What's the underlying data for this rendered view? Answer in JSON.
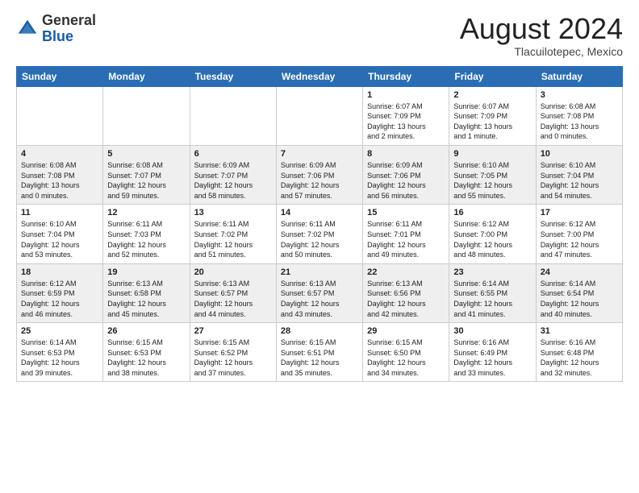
{
  "header": {
    "logo_general": "General",
    "logo_blue": "Blue",
    "month_year": "August 2024",
    "location": "Tlacuilotepec, Mexico"
  },
  "days_of_week": [
    "Sunday",
    "Monday",
    "Tuesday",
    "Wednesday",
    "Thursday",
    "Friday",
    "Saturday"
  ],
  "weeks": [
    [
      {
        "day": "",
        "info": ""
      },
      {
        "day": "",
        "info": ""
      },
      {
        "day": "",
        "info": ""
      },
      {
        "day": "",
        "info": ""
      },
      {
        "day": "1",
        "info": "Sunrise: 6:07 AM\nSunset: 7:09 PM\nDaylight: 13 hours\nand 2 minutes."
      },
      {
        "day": "2",
        "info": "Sunrise: 6:07 AM\nSunset: 7:09 PM\nDaylight: 13 hours\nand 1 minute."
      },
      {
        "day": "3",
        "info": "Sunrise: 6:08 AM\nSunset: 7:08 PM\nDaylight: 13 hours\nand 0 minutes."
      }
    ],
    [
      {
        "day": "4",
        "info": "Sunrise: 6:08 AM\nSunset: 7:08 PM\nDaylight: 13 hours\nand 0 minutes."
      },
      {
        "day": "5",
        "info": "Sunrise: 6:08 AM\nSunset: 7:07 PM\nDaylight: 12 hours\nand 59 minutes."
      },
      {
        "day": "6",
        "info": "Sunrise: 6:09 AM\nSunset: 7:07 PM\nDaylight: 12 hours\nand 58 minutes."
      },
      {
        "day": "7",
        "info": "Sunrise: 6:09 AM\nSunset: 7:06 PM\nDaylight: 12 hours\nand 57 minutes."
      },
      {
        "day": "8",
        "info": "Sunrise: 6:09 AM\nSunset: 7:06 PM\nDaylight: 12 hours\nand 56 minutes."
      },
      {
        "day": "9",
        "info": "Sunrise: 6:10 AM\nSunset: 7:05 PM\nDaylight: 12 hours\nand 55 minutes."
      },
      {
        "day": "10",
        "info": "Sunrise: 6:10 AM\nSunset: 7:04 PM\nDaylight: 12 hours\nand 54 minutes."
      }
    ],
    [
      {
        "day": "11",
        "info": "Sunrise: 6:10 AM\nSunset: 7:04 PM\nDaylight: 12 hours\nand 53 minutes."
      },
      {
        "day": "12",
        "info": "Sunrise: 6:11 AM\nSunset: 7:03 PM\nDaylight: 12 hours\nand 52 minutes."
      },
      {
        "day": "13",
        "info": "Sunrise: 6:11 AM\nSunset: 7:02 PM\nDaylight: 12 hours\nand 51 minutes."
      },
      {
        "day": "14",
        "info": "Sunrise: 6:11 AM\nSunset: 7:02 PM\nDaylight: 12 hours\nand 50 minutes."
      },
      {
        "day": "15",
        "info": "Sunrise: 6:11 AM\nSunset: 7:01 PM\nDaylight: 12 hours\nand 49 minutes."
      },
      {
        "day": "16",
        "info": "Sunrise: 6:12 AM\nSunset: 7:00 PM\nDaylight: 12 hours\nand 48 minutes."
      },
      {
        "day": "17",
        "info": "Sunrise: 6:12 AM\nSunset: 7:00 PM\nDaylight: 12 hours\nand 47 minutes."
      }
    ],
    [
      {
        "day": "18",
        "info": "Sunrise: 6:12 AM\nSunset: 6:59 PM\nDaylight: 12 hours\nand 46 minutes."
      },
      {
        "day": "19",
        "info": "Sunrise: 6:13 AM\nSunset: 6:58 PM\nDaylight: 12 hours\nand 45 minutes."
      },
      {
        "day": "20",
        "info": "Sunrise: 6:13 AM\nSunset: 6:57 PM\nDaylight: 12 hours\nand 44 minutes."
      },
      {
        "day": "21",
        "info": "Sunrise: 6:13 AM\nSunset: 6:57 PM\nDaylight: 12 hours\nand 43 minutes."
      },
      {
        "day": "22",
        "info": "Sunrise: 6:13 AM\nSunset: 6:56 PM\nDaylight: 12 hours\nand 42 minutes."
      },
      {
        "day": "23",
        "info": "Sunrise: 6:14 AM\nSunset: 6:55 PM\nDaylight: 12 hours\nand 41 minutes."
      },
      {
        "day": "24",
        "info": "Sunrise: 6:14 AM\nSunset: 6:54 PM\nDaylight: 12 hours\nand 40 minutes."
      }
    ],
    [
      {
        "day": "25",
        "info": "Sunrise: 6:14 AM\nSunset: 6:53 PM\nDaylight: 12 hours\nand 39 minutes."
      },
      {
        "day": "26",
        "info": "Sunrise: 6:15 AM\nSunset: 6:53 PM\nDaylight: 12 hours\nand 38 minutes."
      },
      {
        "day": "27",
        "info": "Sunrise: 6:15 AM\nSunset: 6:52 PM\nDaylight: 12 hours\nand 37 minutes."
      },
      {
        "day": "28",
        "info": "Sunrise: 6:15 AM\nSunset: 6:51 PM\nDaylight: 12 hours\nand 35 minutes."
      },
      {
        "day": "29",
        "info": "Sunrise: 6:15 AM\nSunset: 6:50 PM\nDaylight: 12 hours\nand 34 minutes."
      },
      {
        "day": "30",
        "info": "Sunrise: 6:16 AM\nSunset: 6:49 PM\nDaylight: 12 hours\nand 33 minutes."
      },
      {
        "day": "31",
        "info": "Sunrise: 6:16 AM\nSunset: 6:48 PM\nDaylight: 12 hours\nand 32 minutes."
      }
    ]
  ]
}
